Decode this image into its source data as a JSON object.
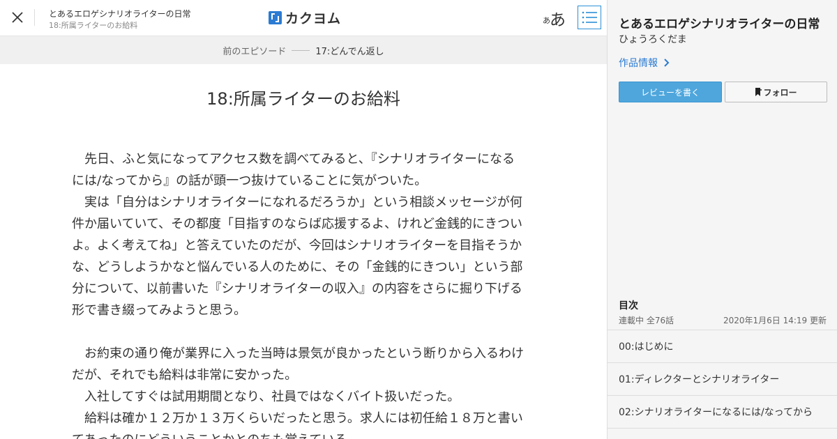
{
  "header": {
    "work_title": "とあるエロゲシナリオライターの日常",
    "episode_title": "18:所属ライターのお給料",
    "logo_text": "カクヨム",
    "font_size_small": "あ",
    "font_size_large": "あ"
  },
  "nav": {
    "prev_label": "前のエピソード",
    "prev_episode": "17:どんでん返し"
  },
  "episode": {
    "title": "18:所属ライターのお給料",
    "paragraphs": [
      "　先日、ふと気になってアクセス数を調べてみると、『シナリオライターになる",
      "には/なってから』の話が頭一つ抜けていることに気がついた。",
      "　実は「自分はシナリオライターになれるだろうか」という相談メッセージが何",
      "件か届いていて、その都度「目指すのならば応援するよ、けれど金銭的にきつい",
      "よ。よく考えてね」と答えていたのだが、今回はシナリオライターを目指そうか",
      "な、どうしようかなと悩んでいる人のために、その「金銭的にきつい」という部",
      "分について、以前書いた『シナリオライターの収入』の内容をさらに掘り下げる",
      "形で書き綴ってみようと思う。",
      "",
      "　お約束の通り俺が業界に入った当時は景気が良かったという断りから入るわけ",
      "だが、それでも給料は非常に安かった。",
      "　入社してすぐは試用期間となり、社員ではなくバイト扱いだった。",
      "　給料は確か１２万か１３万くらいだったと思う。求人には初任給１８万と書い",
      "てあったのにどういうことかとのちも覚えている。"
    ]
  },
  "side": {
    "title": "とあるエロゲシナリオライターの日常",
    "author": "ひょうろくだま",
    "info_link": "作品情報",
    "review_button": "レビューを書く",
    "follow_button": "フォロー",
    "toc_heading": "目次",
    "toc_status": "連載中 全76話",
    "toc_updated": "2020年1月6日 14:19 更新",
    "toc_items": [
      "00:はじめに",
      "01:ディレクターとシナリオライター",
      "02:シナリオライターになるには/なってから"
    ]
  },
  "colors": {
    "accent": "#2b7bd2",
    "review_button_bg": "#4ea6dc",
    "side_bg": "#f5f5f5",
    "nav_bar_bg": "#f0f0f0"
  },
  "icons": {
    "close": "close-icon",
    "menu": "list-icon",
    "chevron": "chevron-right-icon",
    "bookmark": "bookmark-plus-icon"
  }
}
